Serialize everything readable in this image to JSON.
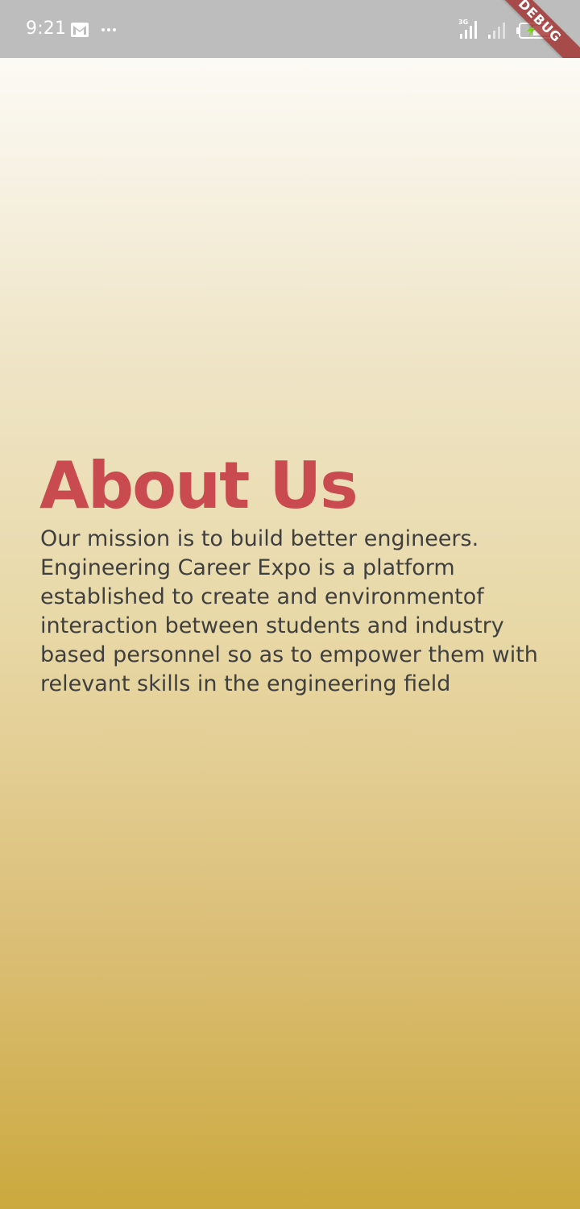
{
  "status_bar": {
    "time": "9:21",
    "notification_icons": [
      "gmail-icon",
      "more-icon"
    ],
    "system_icons": [
      "signal-3g-icon",
      "signal-icon",
      "battery-charging-icon"
    ],
    "network_label": "3G",
    "background_color": "#bdbdbd"
  },
  "debug_banner": {
    "label": "DEBUG"
  },
  "about": {
    "title": "About Us",
    "title_color": "#c94b4f",
    "body_lines": [
      "Our mission is to build better engineers.",
      "Engineering Career Expo is a platform",
      "established to create and environmentof",
      "interaction between students and industry",
      "based personnel so as to empower them with",
      "relevant skills in the engineering field"
    ],
    "body_color": "#3f3f3f"
  },
  "background_gradient": [
    "#fcfaf5",
    "#e8d8a6",
    "#cba93e"
  ]
}
